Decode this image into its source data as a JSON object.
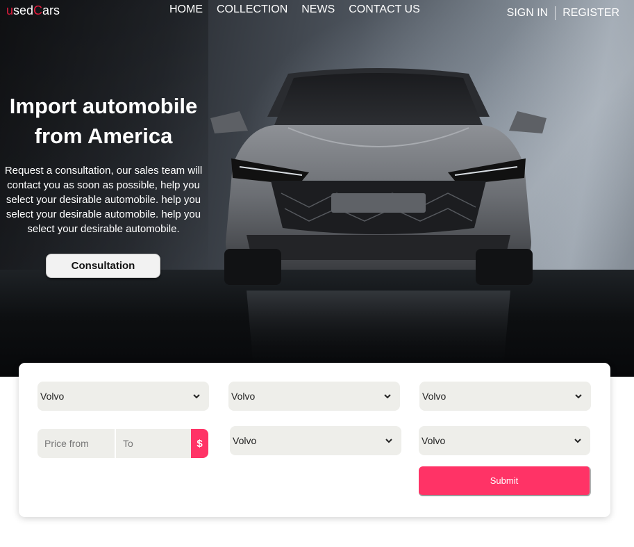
{
  "brand": {
    "prefix_accent": "u",
    "prefix": "sed",
    "mid_accent": "C",
    "suffix": "ars"
  },
  "nav": {
    "home": "HOME",
    "collection": "COLLECTION",
    "news": "NEWS",
    "contact": "CONTACT US"
  },
  "auth": {
    "sign_in": "SIGN IN",
    "register": "REGISTER"
  },
  "hero": {
    "title_line1": "Import automobile",
    "title_line2": "from America",
    "description": "Request a consultation, our sales team will contact you as soon as possible, help you select your desirable automobile. help you select your desirable automobile. help you select your desirable automobile.",
    "cta_label": "Consultation"
  },
  "search": {
    "row1": [
      {
        "value": "Volvo"
      },
      {
        "value": "Volvo"
      },
      {
        "value": "Volvo"
      }
    ],
    "price_from_placeholder": "Price from",
    "price_to_placeholder": "To",
    "currency_symbol": "$",
    "row2": [
      {
        "value": "Volvo"
      },
      {
        "value": "Volvo"
      }
    ],
    "submit_label": "Submit"
  },
  "colors": {
    "accent": "#ff3366",
    "brand_accent": "#e31c3d",
    "field_bg": "#eeeeea"
  },
  "icons": {
    "select_arrow": "chevron-down-icon"
  }
}
